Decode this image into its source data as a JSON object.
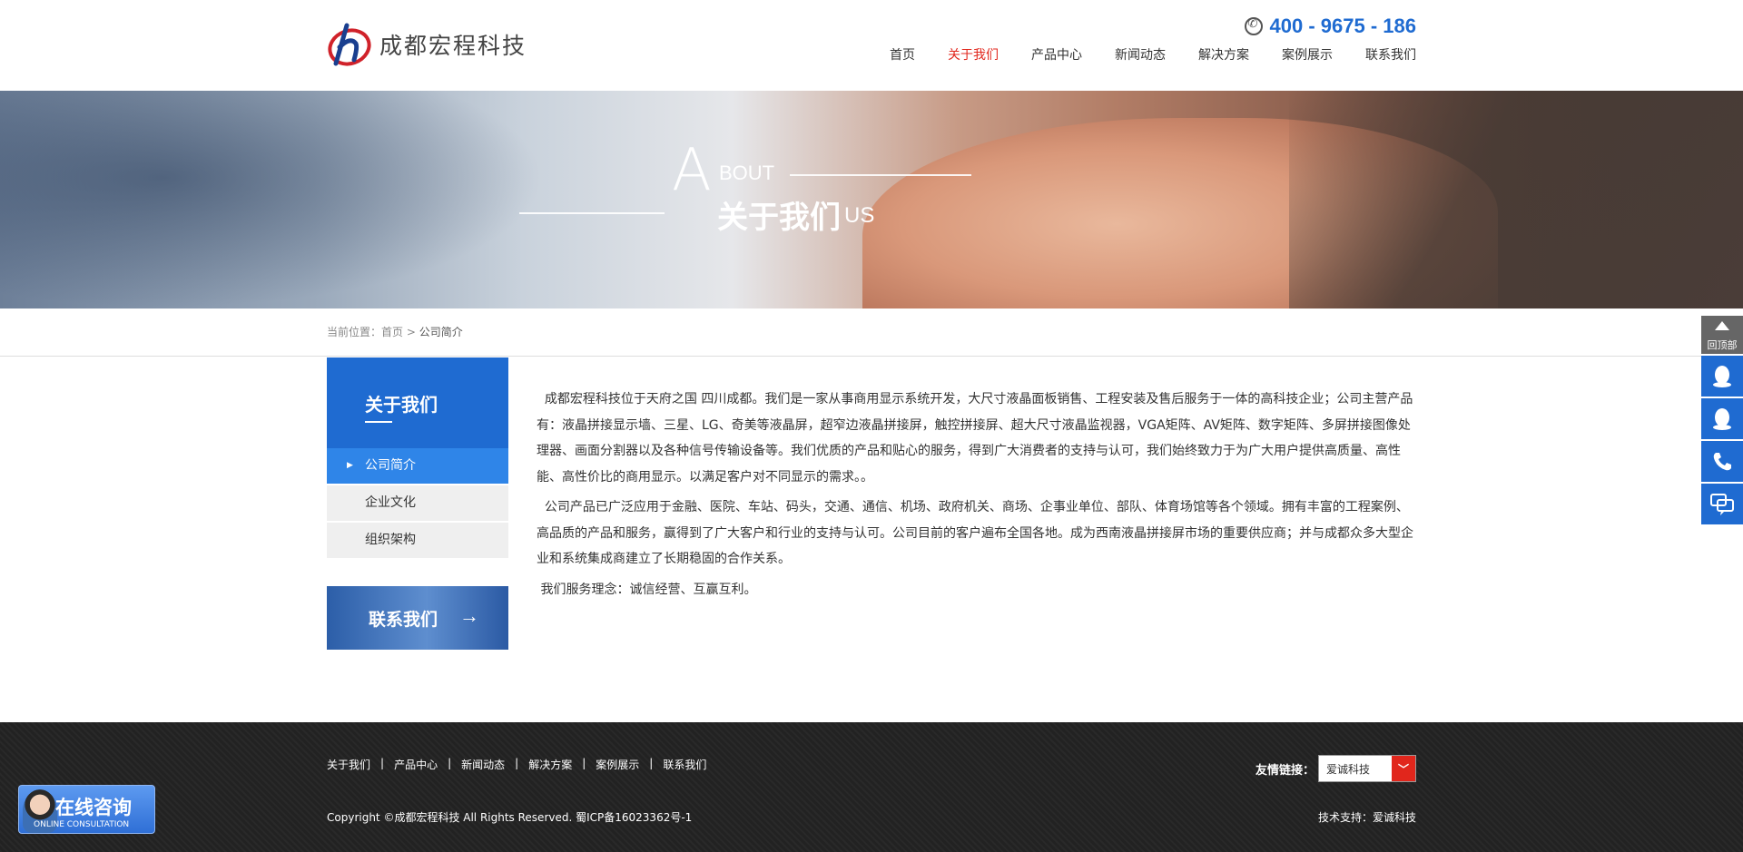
{
  "header": {
    "logo_text": "成都宏程科技",
    "hotline": "400 - 9675 - 186",
    "nav": [
      "首页",
      "关于我们",
      "产品中心",
      "新闻动态",
      "解决方案",
      "案例展示",
      "联系我们"
    ]
  },
  "banner": {
    "big_letter": "A",
    "bout": "BOUT",
    "title_cn": "关于我们",
    "us": "US"
  },
  "breadcrumb": {
    "prefix": "当前位置：",
    "home": "首页",
    "sep": " > ",
    "current": "公司简介"
  },
  "sidebar": {
    "title": "关于我们",
    "items": [
      "公司简介",
      "企业文化",
      "组织架构"
    ],
    "contact_label": "联系我们"
  },
  "content": {
    "p1": "成都宏程科技位于天府之国 四川成都。我们是一家从事商用显示系统开发，大尺寸液晶面板销售、工程安装及售后服务于一体的高科技企业；公司主营产品有：液晶拼接显示墙、三星、LG、奇美等液晶屏，超窄边液晶拼接屏，触控拼接屏、超大尺寸液晶监视器，VGA矩阵、AV矩阵、数字矩阵、多屏拼接图像处理器、画面分割器以及各种信号传输设备等。我们优质的产品和贴心的服务，得到广大消费者的支持与认可，我们始终致力于为广大用户提供高质量、高性能、高性价比的商用显示。以满足客户对不同显示的需求。。",
    "p2": "公司产品已广泛应用于金融、医院、车站、码头，交通、通信、机场、政府机关、商场、企事业单位、部队、体育场馆等各个领域。拥有丰富的工程案例、高品质的产品和服务，赢得到了广大客户和行业的支持与认可。公司目前的客户遍布全国各地。成为西南液晶拼接屏市场的重要供应商；并与成都众多大型企业和系统集成商建立了长期稳固的合作关系。",
    "p3": "我们服务理念：诚信经营、互赢互利。"
  },
  "float": {
    "top_label": "回顶部"
  },
  "footer": {
    "nav": [
      "关于我们",
      "产品中心",
      "新闻动态",
      "解决方案",
      "案例展示",
      "联系我们"
    ],
    "separator": "|",
    "friend_label": "友情链接：",
    "friend_selected": "爱诚科技",
    "copyright": "Copyright ©成都宏程科技 All Rights Reserved. 蜀ICP备16023362号-1",
    "tech": "技术支持：爱诚科技"
  },
  "online": {
    "title": "在线咨询",
    "subtitle": "ONLINE CONSULTATION"
  },
  "colors": {
    "primary": "#1f6bd1",
    "accent": "#e1261c",
    "footer_bg": "#222222"
  }
}
